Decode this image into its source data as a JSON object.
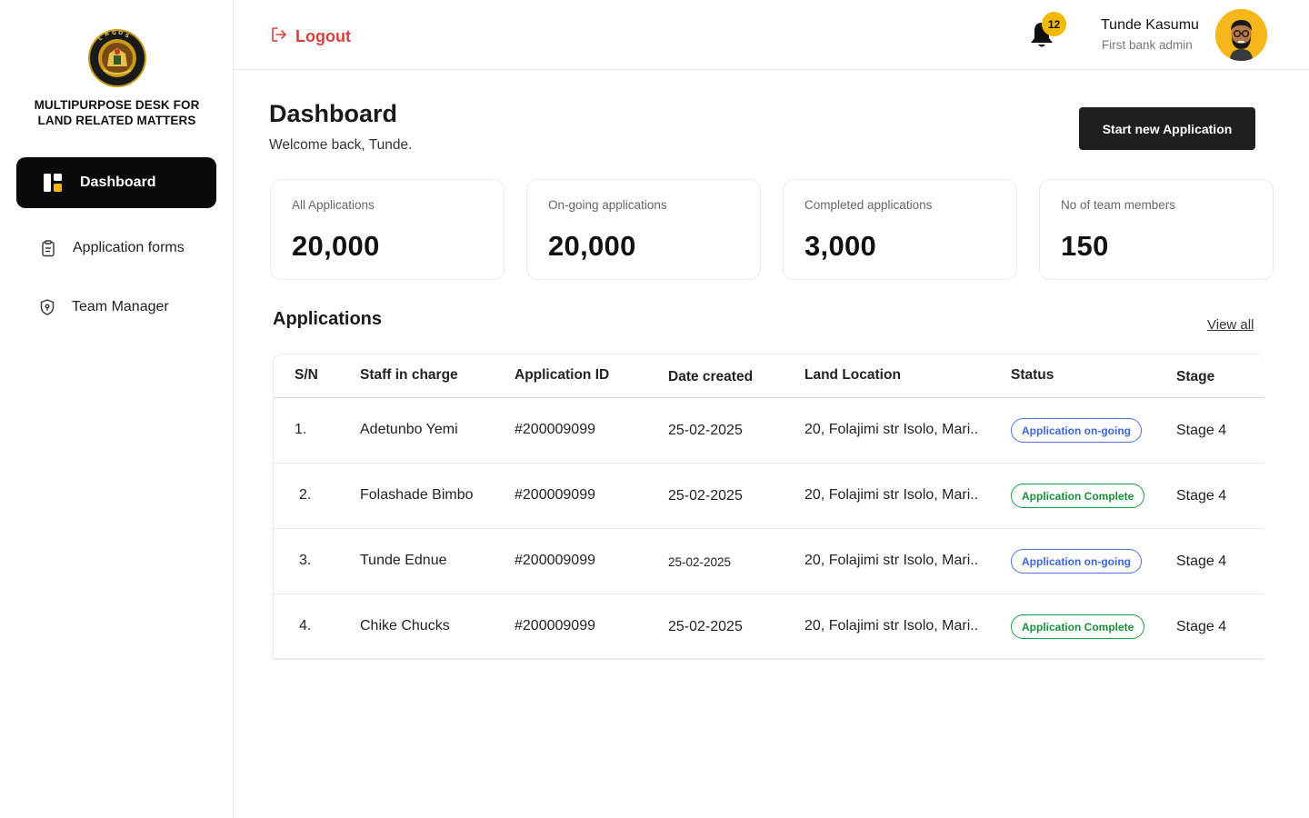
{
  "sidebar": {
    "org_name_line1": "MULTIPURPOSE DESK FOR",
    "org_name_line2": "LAND RELATED MATTERS",
    "logo_text": "LAGOS STATE GOVERNMENT",
    "items": [
      {
        "label": "Dashboard",
        "icon": "dashboard-icon",
        "active": true
      },
      {
        "label": "Application forms",
        "icon": "clipboard-icon",
        "active": false
      },
      {
        "label": "Team Manager",
        "icon": "shield-icon",
        "active": false
      }
    ]
  },
  "header": {
    "logout_label": "Logout",
    "notification_count": "12",
    "user_name": "Tunde Kasumu",
    "user_role": "First bank admin"
  },
  "main": {
    "title": "Dashboard",
    "welcome": "Welcome back, Tunde.",
    "start_button": "Start new Application",
    "stats": [
      {
        "label": "All Applications",
        "value": "20,000"
      },
      {
        "label": "On-going applications",
        "value": "20,000"
      },
      {
        "label": "Completed applications",
        "value": "3,000"
      },
      {
        "label": "No of team members",
        "value": "150"
      }
    ],
    "applications_title": "Applications",
    "view_all": "View all",
    "table": {
      "headers": [
        "S/N",
        "Staff in charge",
        "Application ID",
        "Date created",
        "Land Location",
        "Status",
        "Stage"
      ],
      "rows": [
        {
          "sn": "1.",
          "staff": "Adetunbo Yemi",
          "app_id": "#200009099",
          "date": "25-02-2025",
          "location": "20, Folajimi str Isolo, Mari..",
          "status": "Application on-going",
          "status_type": "ongoing",
          "stage": "Stage 4"
        },
        {
          "sn": "2.",
          "staff": "Folashade Bimbo",
          "app_id": "#200009099",
          "date": "25-02-2025",
          "location": "20, Folajimi str Isolo, Mari..",
          "status": "Application Complete",
          "status_type": "complete",
          "stage": "Stage 4"
        },
        {
          "sn": "3.",
          "staff": "Tunde Ednue",
          "app_id": "#200009099",
          "date": "25-02-2025",
          "location": "20, Folajimi str Isolo, Mari..",
          "status": "Application on-going",
          "status_type": "ongoing",
          "stage": "Stage 4"
        },
        {
          "sn": "4.",
          "staff": "Chike Chucks",
          "app_id": "#200009099",
          "date": "25-02-2025",
          "location": "20, Folajimi str Isolo, Mari..",
          "status": "Application Complete",
          "status_type": "complete",
          "stage": "Stage 4"
        }
      ]
    }
  },
  "colors": {
    "accent_dark": "#0a0a0a",
    "logout_red": "#d9423a",
    "badge_yellow": "#f5b800",
    "status_ongoing": "#3d67d6",
    "status_complete": "#1b8e35"
  }
}
